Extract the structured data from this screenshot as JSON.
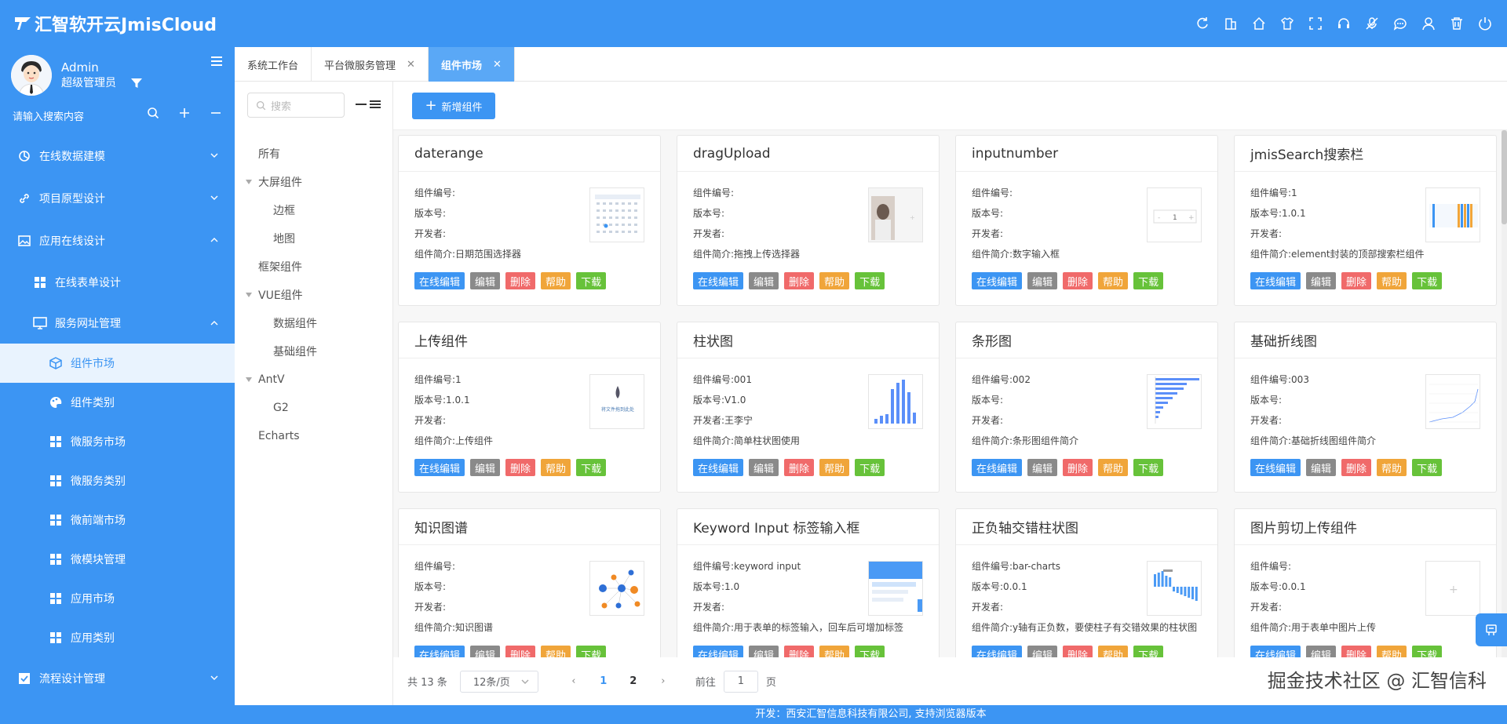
{
  "app": {
    "title": "汇智软开云JmisCloud"
  },
  "header": {
    "icons": [
      "refresh-icon",
      "building-icon",
      "home-icon",
      "shirt-icon",
      "fullscreen-icon",
      "headset-icon",
      "mic-off-icon",
      "chat-icon",
      "user-icon",
      "trash-icon",
      "power-icon"
    ]
  },
  "user": {
    "name": "Admin",
    "role": "超级管理员"
  },
  "sidebar": {
    "search_placeholder": "请输入搜索内容",
    "items": [
      {
        "label": "在线数据建模",
        "icon": "data-model-icon",
        "level": 0,
        "expanded": false
      },
      {
        "label": "项目原型设计",
        "icon": "link-icon",
        "level": 0,
        "expanded": false
      },
      {
        "label": "应用在线设计",
        "icon": "image-icon",
        "level": 0,
        "expanded": true
      },
      {
        "label": "在线表单设计",
        "icon": "grid-icon",
        "level": 1
      },
      {
        "label": "服务网址管理",
        "icon": "monitor-icon",
        "level": 1,
        "expanded": true
      },
      {
        "label": "组件市场",
        "icon": "cube-icon",
        "level": 2,
        "active": true
      },
      {
        "label": "组件类别",
        "icon": "palette-icon",
        "level": 2
      },
      {
        "label": "微服务市场",
        "icon": "grid-icon",
        "level": 2
      },
      {
        "label": "微服务类别",
        "icon": "grid-icon",
        "level": 2
      },
      {
        "label": "微前端市场",
        "icon": "grid-icon",
        "level": 2
      },
      {
        "label": "微模块管理",
        "icon": "grid-icon",
        "level": 2
      },
      {
        "label": "应用市场",
        "icon": "grid-icon",
        "level": 2
      },
      {
        "label": "应用类别",
        "icon": "grid-icon",
        "level": 2
      },
      {
        "label": "流程设计管理",
        "icon": "check-square-icon",
        "level": 0,
        "expanded": false
      }
    ]
  },
  "tabs": [
    {
      "label": "系统工作台",
      "closable": false,
      "active": false
    },
    {
      "label": "平台微服务管理",
      "closable": true,
      "active": false
    },
    {
      "label": "组件市场",
      "closable": true,
      "active": true
    }
  ],
  "tree": {
    "search_placeholder": "搜索",
    "nodes": [
      {
        "label": "所有",
        "level": 0,
        "expandable": false
      },
      {
        "label": "大屏组件",
        "level": 0,
        "expandable": true
      },
      {
        "label": "边框",
        "level": 1
      },
      {
        "label": "地图",
        "level": 1
      },
      {
        "label": "框架组件",
        "level": 0,
        "expandable": false
      },
      {
        "label": "VUE组件",
        "level": 0,
        "expandable": true
      },
      {
        "label": "数据组件",
        "level": 1
      },
      {
        "label": "基础组件",
        "level": 1
      },
      {
        "label": "AntV",
        "level": 0,
        "expandable": true
      },
      {
        "label": "G2",
        "level": 1
      },
      {
        "label": "Echarts",
        "level": 0,
        "expandable": false
      }
    ]
  },
  "toolbar": {
    "add_label": "新增组件"
  },
  "labels": {
    "code": "组件编号:",
    "version": "版本号:",
    "developer": "开发者:",
    "desc": "组件简介:"
  },
  "buttons": {
    "edit_online": "在线编辑",
    "edit": "编辑",
    "delete": "删除",
    "help": "帮助",
    "download": "下载"
  },
  "cards": [
    {
      "title": "daterange",
      "code": "",
      "version": "",
      "developer": "",
      "desc": "日期范围选择器",
      "thumb": "calendar"
    },
    {
      "title": "dragUpload",
      "code": "",
      "version": "",
      "developer": "",
      "desc": "拖拽上传选择器",
      "thumb": "photo"
    },
    {
      "title": "inputnumber",
      "code": "",
      "version": "",
      "developer": "",
      "desc": "数字输入框",
      "thumb": "stepper"
    },
    {
      "title": "jmisSearch搜索栏",
      "code": "1",
      "version": "1.0.1",
      "developer": "",
      "desc": "element封装的顶部搜索栏组件",
      "thumb": "searchbar"
    },
    {
      "title": "上传组件",
      "code": "1",
      "version": "1.0.1",
      "developer": "",
      "desc": "上传组件",
      "thumb": "upload"
    },
    {
      "title": "柱状图",
      "code": "001",
      "version": "V1.0",
      "developer": "王李宁",
      "desc": "简单柱状图使用",
      "thumb": "bars"
    },
    {
      "title": "条形图",
      "code": "002",
      "version": "",
      "developer": "",
      "desc": "条形图组件简介",
      "thumb": "hbars"
    },
    {
      "title": "基础折线图",
      "code": "003",
      "version": "",
      "developer": "",
      "desc": "基础折线图组件简介",
      "thumb": "line"
    },
    {
      "title": "知识图谱",
      "code": "",
      "version": "",
      "developer": "",
      "desc": "知识图谱",
      "thumb": "graph"
    },
    {
      "title": "Keyword Input 标签输入框",
      "code": "keyword input",
      "version": "1.0",
      "developer": "",
      "desc": "用于表单的标签输入，回车后可增加标签",
      "thumb": "tags"
    },
    {
      "title": "正负轴交错柱状图",
      "code": "bar-charts",
      "version": "0.0.1",
      "developer": "",
      "desc": "y轴有正负数，要使柱子有交错效果的柱状图",
      "thumb": "posneg"
    },
    {
      "title": "图片剪切上传组件",
      "code": "",
      "version": "0.0.1",
      "developer": "",
      "desc": "用于表单中图片上传",
      "thumb": "plus"
    }
  ],
  "pagination": {
    "total": "共 13 条",
    "page_size": "12条/页",
    "pages": [
      "1",
      "2"
    ],
    "current": "1",
    "goto_prefix": "前往",
    "goto_value": "1",
    "goto_suffix": "页"
  },
  "watermark": "掘金技术社区 @ 汇智信科",
  "footer": {
    "text": "开发：西安汇智信息科技有限公司, 支持浏览器版本"
  },
  "colors": {
    "primary": "#3c95f3",
    "active_bg": "#e9f3fe",
    "danger": "#f06a6a",
    "warning": "#f0a53a",
    "success": "#67c23a",
    "neutral": "#8a8a8a"
  }
}
